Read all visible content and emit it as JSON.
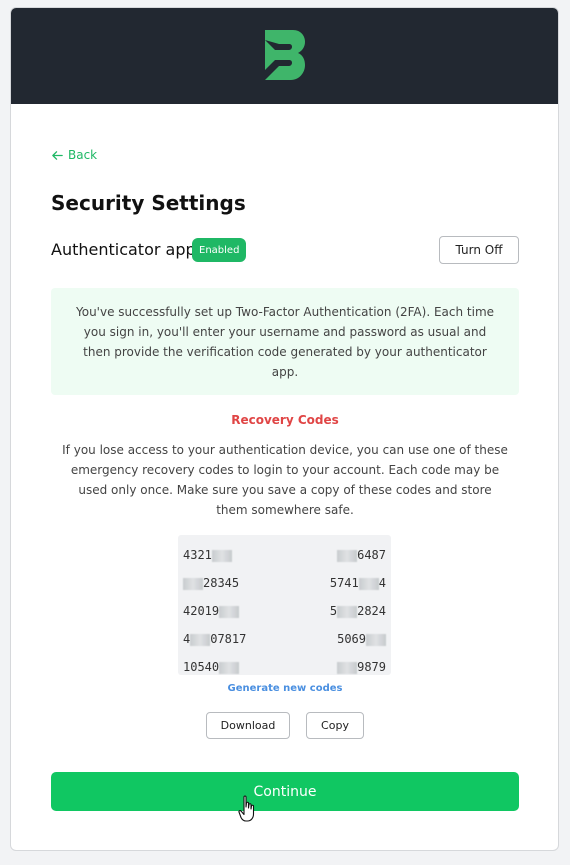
{
  "header": {
    "logo_icon": "b-logo-icon",
    "brand_color": "#3fb56a"
  },
  "nav": {
    "back_label": "Back"
  },
  "page": {
    "title": "Security Settings"
  },
  "auth": {
    "label": "Authenticator app",
    "status_badge": "Enabled",
    "turn_off_label": "Turn Off"
  },
  "info": {
    "message": "You've successfully set up Two-Factor Authentication (2FA). Each time you sign in, you'll enter your username and password as usual and then provide the verification code generated by your authenticator app."
  },
  "recovery": {
    "title": "Recovery Codes",
    "description": "If you lose access to your authentication device, you can use one of these emergency recovery codes to login to your account. Each code may be used only once. Make sure you save a copy of these codes and store them somewhere safe.",
    "codes": [
      {
        "left": {
          "prefix": "4321",
          "suffix": ""
        },
        "right": {
          "prefix": "",
          "suffix": "6487"
        }
      },
      {
        "left": {
          "prefix": "",
          "suffix": "28345"
        },
        "right": {
          "prefix": "5741",
          "suffix": "4"
        }
      },
      {
        "left": {
          "prefix": "42019",
          "suffix": ""
        },
        "right": {
          "prefix": "5",
          "suffix": "2824"
        }
      },
      {
        "left": {
          "prefix": "4",
          "suffix": "07817"
        },
        "right": {
          "prefix": "5069",
          "suffix": ""
        }
      },
      {
        "left": {
          "prefix": "10540",
          "suffix": ""
        },
        "right": {
          "prefix": "",
          "suffix": "9879"
        }
      }
    ],
    "generate_label": "Generate new codes",
    "download_label": "Download",
    "copy_label": "Copy"
  },
  "footer": {
    "continue_label": "Continue"
  },
  "colors": {
    "accent": "#10c762",
    "danger": "#e04545",
    "link": "#4a8fe0",
    "header_bg": "#222831"
  }
}
